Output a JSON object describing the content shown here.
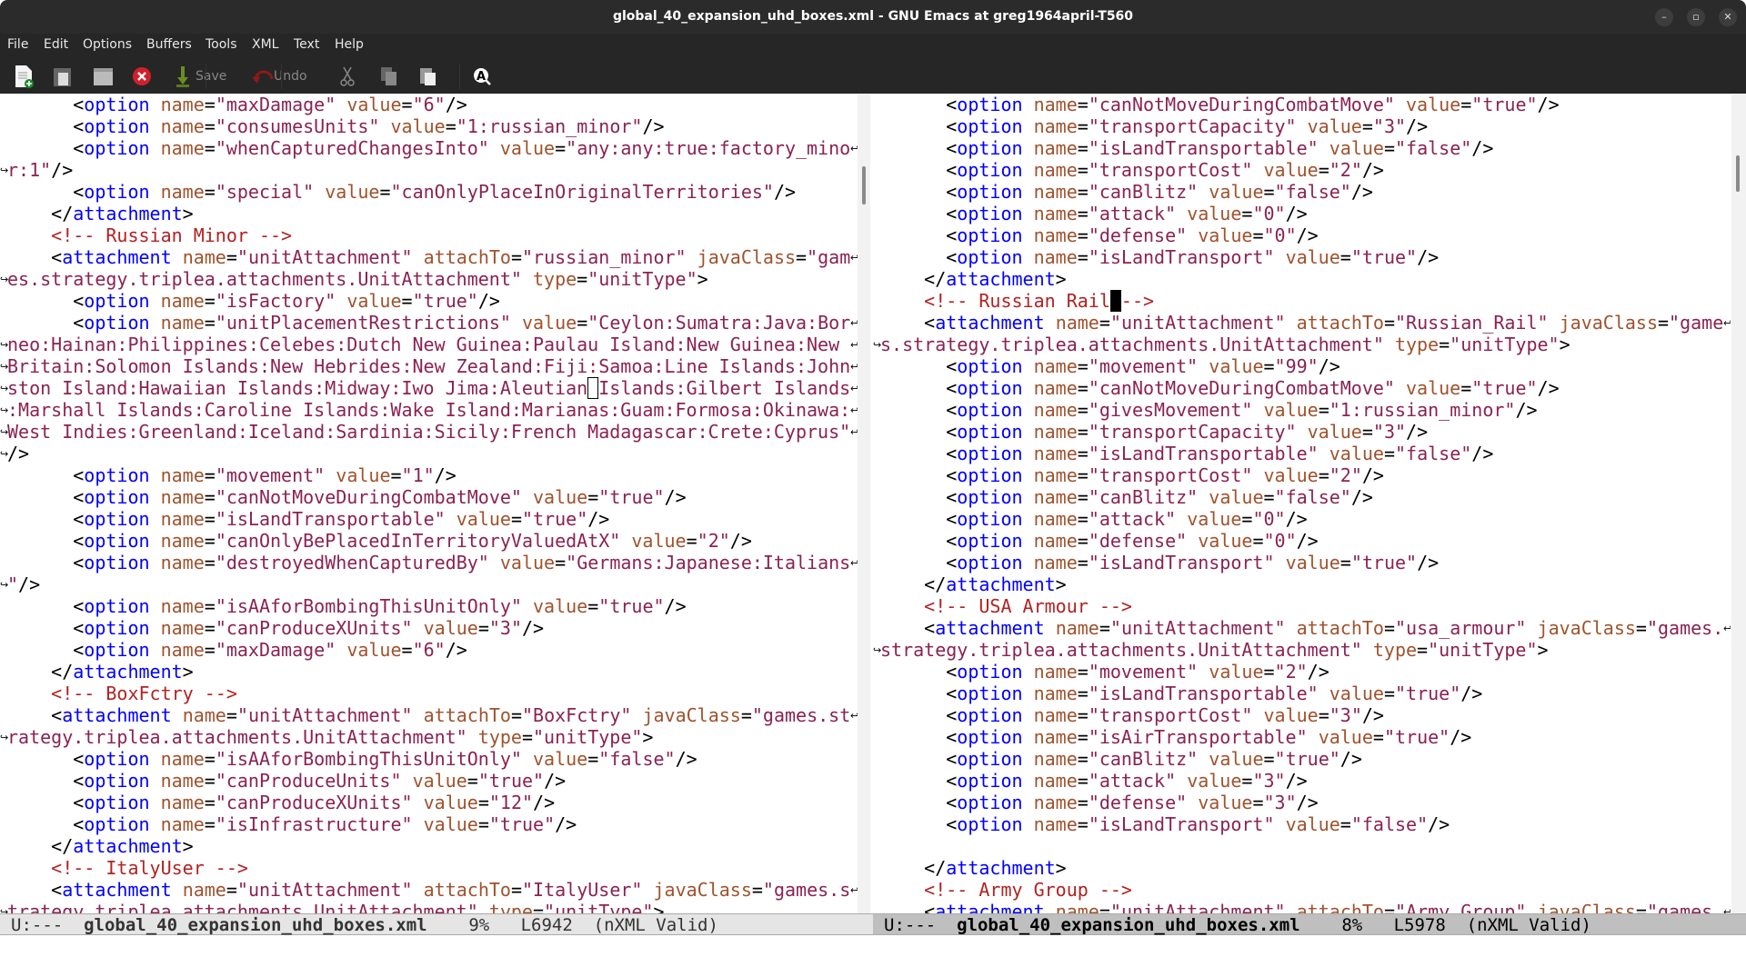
{
  "window": {
    "title": "global_40_expansion_uhd_boxes.xml - GNU Emacs at greg1964april-T560",
    "controls": [
      "minimize",
      "restore",
      "close"
    ]
  },
  "menu": [
    "File",
    "Edit",
    "Options",
    "Buffers",
    "Tools",
    "XML",
    "Text",
    "Help"
  ],
  "toolbar": {
    "save_label": "Save",
    "undo_label": "Undo",
    "icons": [
      "new-file-icon",
      "open-file-icon",
      "open-directory-icon",
      "close-buffer-icon",
      "save-icon",
      "undo-icon",
      "cut-icon",
      "copy-icon",
      "paste-icon",
      "search-icon"
    ]
  },
  "colors": {
    "tag": "#0000ff",
    "attribute": "#a0522d",
    "string": "#8b2252",
    "comment": "#b22222"
  },
  "left_pane": {
    "lines": [
      {
        "t": "      <option name=\"maxDamage\" value=\"6\"/>"
      },
      {
        "t": "      <option name=\"consumesUnits\" value=\"1:russian_minor\"/>"
      },
      {
        "t": "      <option name=\"whenCapturedChangesInto\" value=\"any:any:true:factory_mino",
        "wrap": true
      },
      {
        "t": "r:1\"/>"
      },
      {
        "t": "      <option name=\"special\" value=\"canOnlyPlaceInOriginalTerritories\"/>"
      },
      {
        "t": "    </attachment>"
      },
      {
        "t": "    <!-- Russian Minor -->"
      },
      {
        "t": "    <attachment name=\"unitAttachment\" attachTo=\"russian_minor\" javaClass=\"gam",
        "wrap": true
      },
      {
        "t": "es.strategy.triplea.attachments.UnitAttachment\" type=\"unitType\">"
      },
      {
        "t": "      <option name=\"isFactory\" value=\"true\"/>"
      },
      {
        "t": "      <option name=\"unitPlacementRestrictions\" value=\"Ceylon:Sumatra:Java:Bor",
        "wrap": true
      },
      {
        "t": "neo:Hainan:Philippines:Celebes:Dutch New Guinea:Paulau Island:New Guinea:New ",
        "wrap": true
      },
      {
        "t": "Britain:Solomon Islands:New Hebrides:New Zealand:Fiji:Samoa:Line Islands:John",
        "wrap": true
      },
      {
        "t": "ston Island:Hawaiian Islands:Midway:Iwo Jima:Aleutian Islands:Gilbert Islands",
        "wrap": true
      },
      {
        "t": ":Marshall Islands:Caroline Islands:Wake Island:Marianas:Guam:Formosa:Okinawa:",
        "wrap": true
      },
      {
        "t": "West Indies:Greenland:Iceland:Sardinia:Sicily:French Madagascar:Crete:Cyprus\"",
        "wrap": true
      },
      {
        "t": "/>"
      },
      {
        "t": "      <option name=\"movement\" value=\"1\"/>"
      },
      {
        "t": "      <option name=\"canNotMoveDuringCombatMove\" value=\"true\"/>"
      },
      {
        "t": "      <option name=\"isLandTransportable\" value=\"true\"/>"
      },
      {
        "t": "      <option name=\"canOnlyBePlacedInTerritoryValuedAtX\" value=\"2\"/>"
      },
      {
        "t": "      <option name=\"destroyedWhenCapturedBy\" value=\"Germans:Japanese:Italians",
        "wrap": true
      },
      {
        "t": "\"/>"
      },
      {
        "t": "      <option name=\"isAAforBombingThisUnitOnly\" value=\"true\"/>"
      },
      {
        "t": "      <option name=\"canProduceXUnits\" value=\"3\"/>"
      },
      {
        "t": "      <option name=\"maxDamage\" value=\"6\"/>"
      },
      {
        "t": "    </attachment>"
      },
      {
        "t": "    <!-- BoxFctry -->"
      },
      {
        "t": "    <attachment name=\"unitAttachment\" attachTo=\"BoxFctry\" javaClass=\"games.st",
        "wrap": true
      },
      {
        "t": "rategy.triplea.attachments.UnitAttachment\" type=\"unitType\">"
      },
      {
        "t": "      <option name=\"isAAforBombingThisUnitOnly\" value=\"false\"/>"
      },
      {
        "t": "      <option name=\"canProduceUnits\" value=\"true\"/>"
      },
      {
        "t": "      <option name=\"canProduceXUnits\" value=\"12\"/>"
      },
      {
        "t": "      <option name=\"isInfrastructure\" value=\"true\"/>"
      },
      {
        "t": "    </attachment>"
      },
      {
        "t": "    <!-- ItalyUser -->"
      },
      {
        "t": "    <attachment name=\"unitAttachment\" attachTo=\"ItalyUser\" javaClass=\"games.s",
        "wrap": true
      },
      {
        "t": "trategy.triplea.attachments.UnitAttachment\" type=\"unitType\">"
      }
    ],
    "modeline": {
      "status": "U:---",
      "buffer": "global_40_expansion_uhd_boxes.xml",
      "position": "9%",
      "line": "L6942",
      "mode": "(nXML Valid)"
    }
  },
  "right_pane": {
    "lines": [
      {
        "t": "      <option name=\"canNotMoveDuringCombatMove\" value=\"true\"/>"
      },
      {
        "t": "      <option name=\"transportCapacity\" value=\"3\"/>"
      },
      {
        "t": "      <option name=\"isLandTransportable\" value=\"false\"/>"
      },
      {
        "t": "      <option name=\"transportCost\" value=\"2\"/>"
      },
      {
        "t": "      <option name=\"canBlitz\" value=\"false\"/>"
      },
      {
        "t": "      <option name=\"attack\" value=\"0\"/>"
      },
      {
        "t": "      <option name=\"defense\" value=\"0\"/>"
      },
      {
        "t": "      <option name=\"isLandTransport\" value=\"true\"/>"
      },
      {
        "t": "    </attachment>"
      },
      {
        "t": "    <!-- Russian Rail -->"
      },
      {
        "t": "    <attachment name=\"unitAttachment\" attachTo=\"Russian_Rail\" javaClass=\"game",
        "wrap": true
      },
      {
        "t": "s.strategy.triplea.attachments.UnitAttachment\" type=\"unitType\">"
      },
      {
        "t": "      <option name=\"movement\" value=\"99\"/>"
      },
      {
        "t": "      <option name=\"canNotMoveDuringCombatMove\" value=\"true\"/>"
      },
      {
        "t": "      <option name=\"givesMovement\" value=\"1:russian_minor\"/>"
      },
      {
        "t": "      <option name=\"transportCapacity\" value=\"3\"/>"
      },
      {
        "t": "      <option name=\"isLandTransportable\" value=\"false\"/>"
      },
      {
        "t": "      <option name=\"transportCost\" value=\"2\"/>"
      },
      {
        "t": "      <option name=\"canBlitz\" value=\"false\"/>"
      },
      {
        "t": "      <option name=\"attack\" value=\"0\"/>"
      },
      {
        "t": "      <option name=\"defense\" value=\"0\"/>"
      },
      {
        "t": "      <option name=\"isLandTransport\" value=\"true\"/>"
      },
      {
        "t": "    </attachment>"
      },
      {
        "t": "    <!-- USA Armour -->"
      },
      {
        "t": "    <attachment name=\"unitAttachment\" attachTo=\"usa_armour\" javaClass=\"games.",
        "wrap": true
      },
      {
        "t": "strategy.triplea.attachments.UnitAttachment\" type=\"unitType\">"
      },
      {
        "t": "      <option name=\"movement\" value=\"2\"/>"
      },
      {
        "t": "      <option name=\"isLandTransportable\" value=\"true\"/>"
      },
      {
        "t": "      <option name=\"transportCost\" value=\"3\"/>"
      },
      {
        "t": "      <option name=\"isAirTransportable\" value=\"true\"/>"
      },
      {
        "t": "      <option name=\"canBlitz\" value=\"true\"/>"
      },
      {
        "t": "      <option name=\"attack\" value=\"3\"/>"
      },
      {
        "t": "      <option name=\"defense\" value=\"3\"/>"
      },
      {
        "t": "      <option name=\"isLandTransport\" value=\"false\"/>"
      },
      {
        "t": ""
      },
      {
        "t": "    </attachment>"
      },
      {
        "t": "    <!-- Army Group -->"
      },
      {
        "t": "    <attachment name=\"unitAttachment\" attachTo=\"Army_Group\" javaClass=\"games.",
        "wrap": true
      }
    ],
    "modeline": {
      "status": "U:---",
      "buffer": "global_40_expansion_uhd_boxes.xml",
      "position": "8%",
      "line": "L5978",
      "mode": "(nXML Valid)"
    }
  }
}
